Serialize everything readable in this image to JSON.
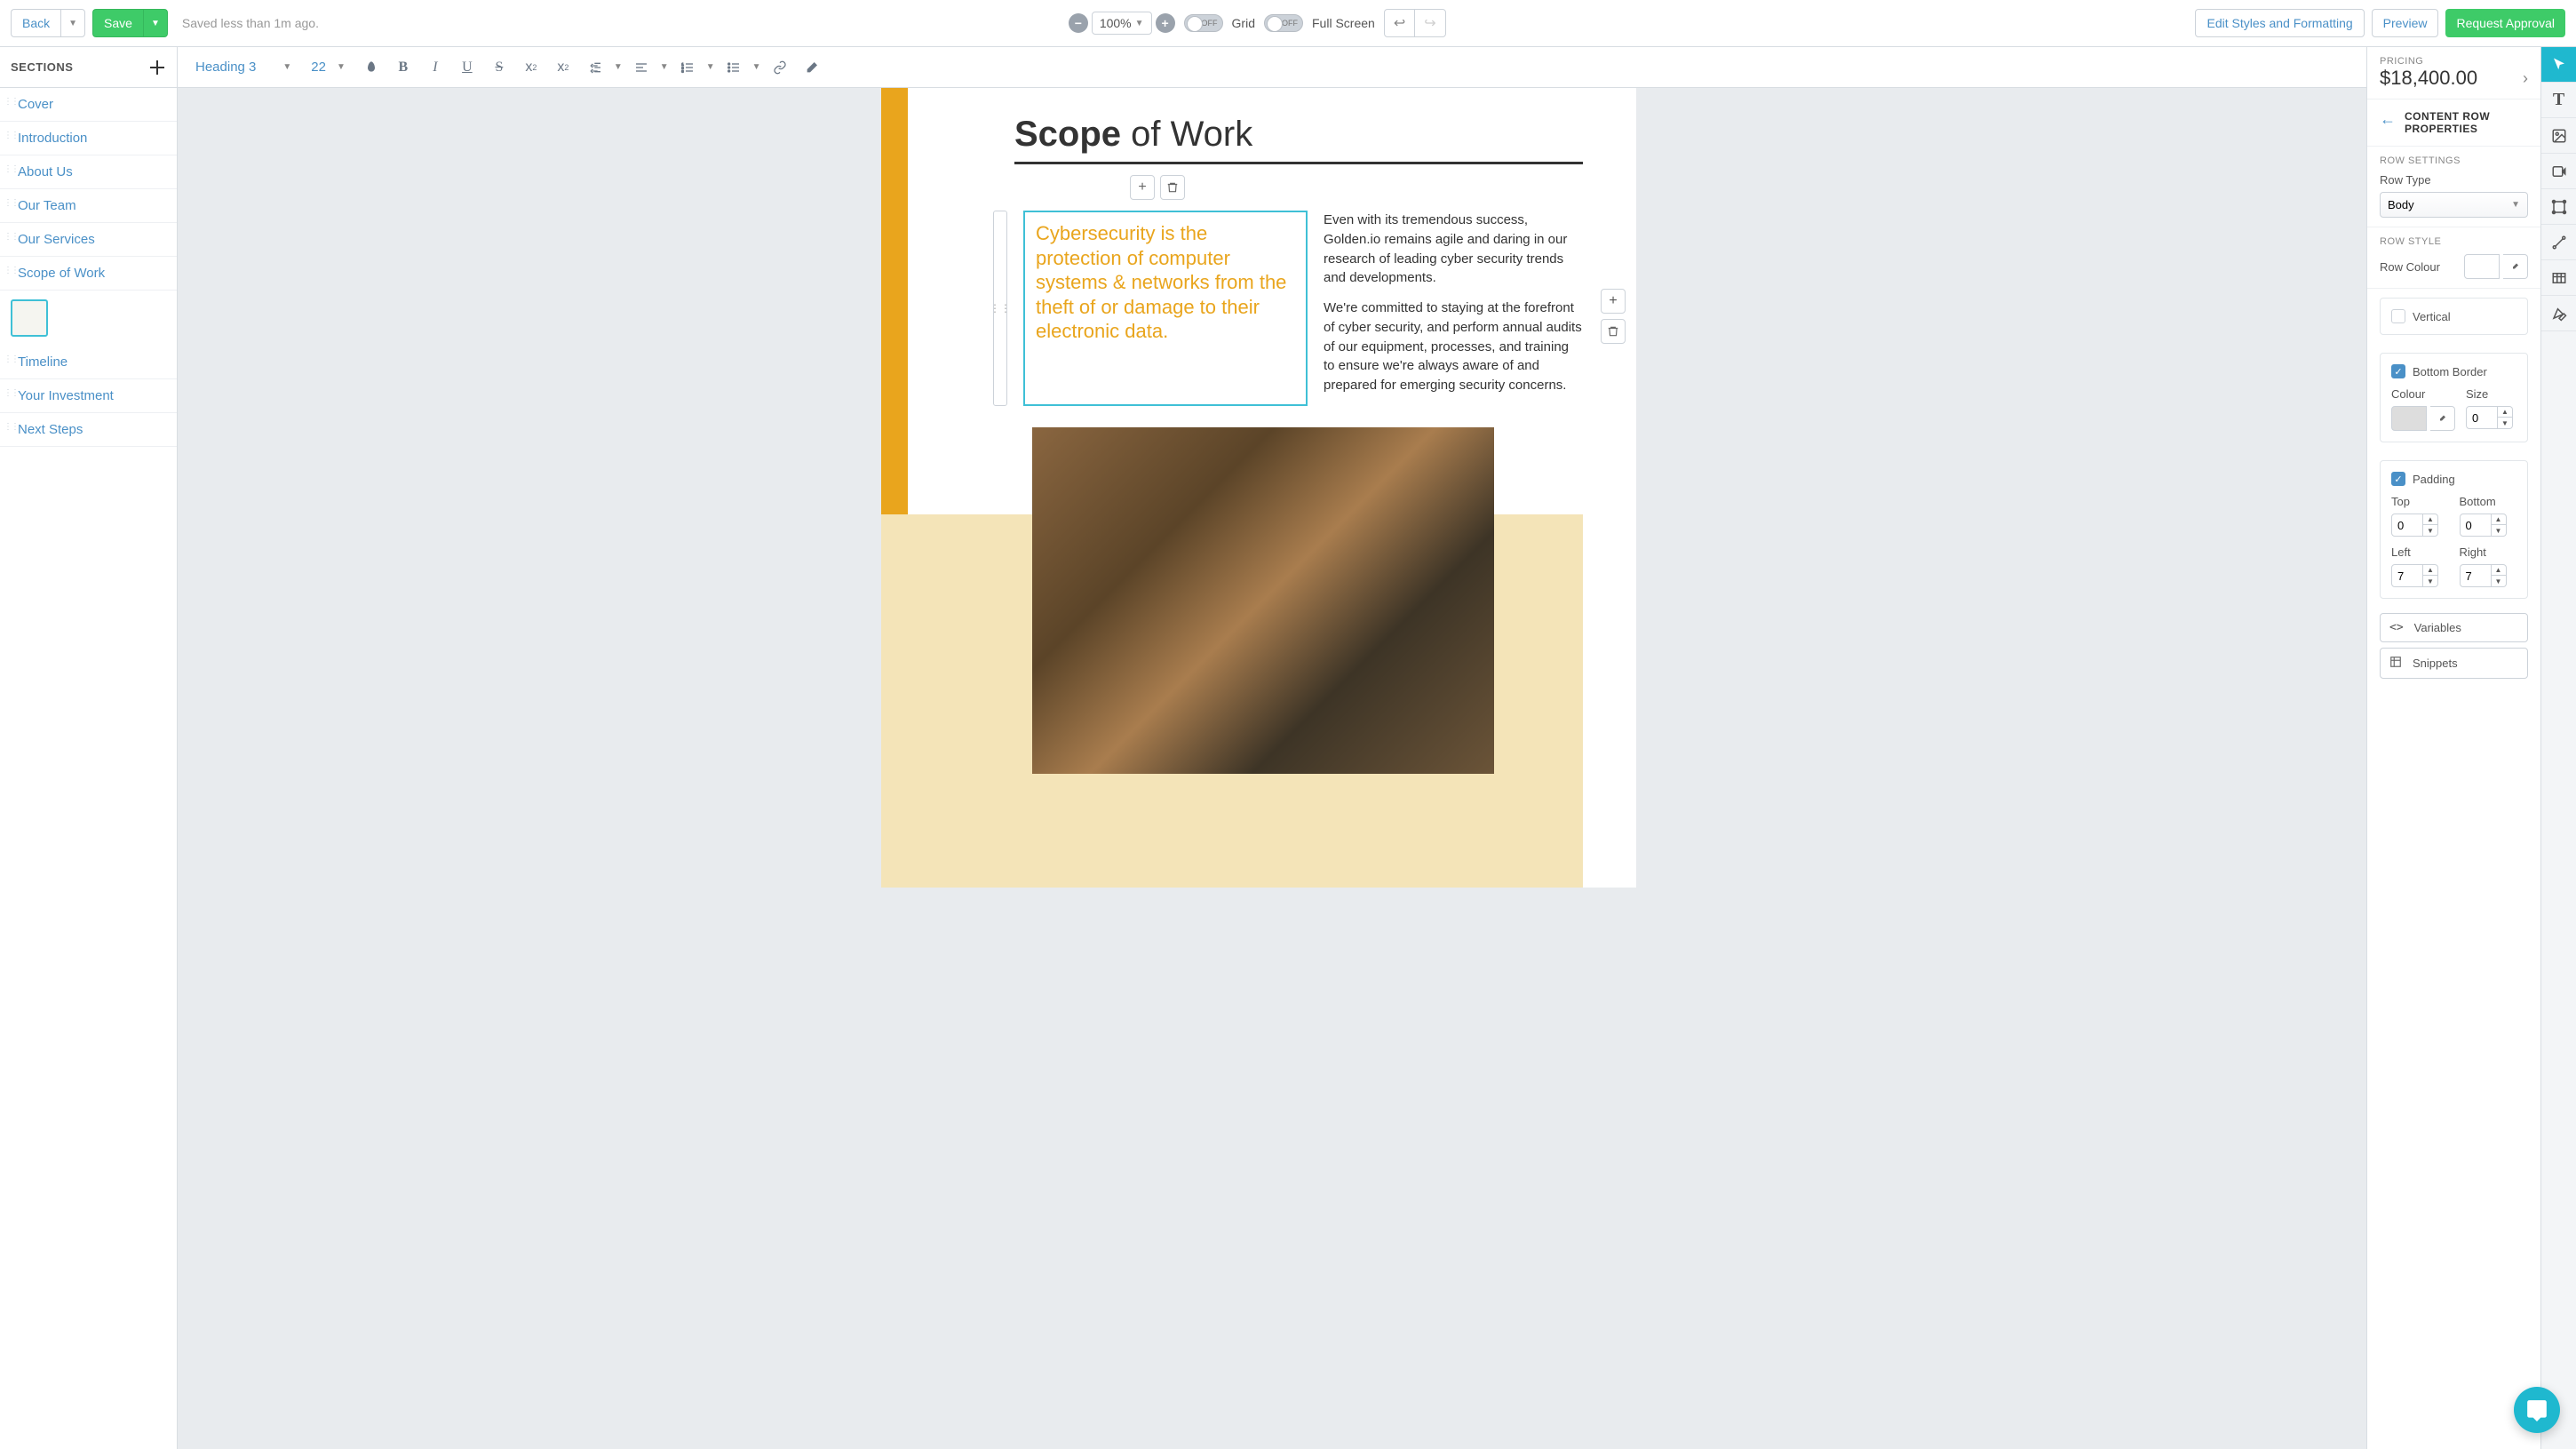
{
  "topbar": {
    "back": "Back",
    "save": "Save",
    "saved_status": "Saved less than 1m ago.",
    "zoom_value": "100%",
    "grid_toggle": "OFF",
    "grid_label": "Grid",
    "fullscreen_toggle": "OFF",
    "fullscreen_label": "Full Screen",
    "edit_styles": "Edit Styles and Formatting",
    "preview": "Preview",
    "request": "Request Approval"
  },
  "sidebar": {
    "header": "SECTIONS",
    "items": [
      {
        "label": "Cover"
      },
      {
        "label": "Introduction"
      },
      {
        "label": "About Us"
      },
      {
        "label": "Our Team"
      },
      {
        "label": "Our Services"
      },
      {
        "label": "Scope of Work",
        "active": true
      },
      {
        "label": "Timeline"
      },
      {
        "label": "Your Investment"
      },
      {
        "label": "Next Steps"
      }
    ]
  },
  "editorToolbar": {
    "style": "Heading 3",
    "size": "22"
  },
  "document": {
    "title_bold": "Scope",
    "title_rest": " of Work",
    "calloutText": "Cybersecurity is the protection of computer systems & networks from the theft of or damage to their electronic data.",
    "bodyP1": "Even with its tremendous success, Golden.io remains agile and daring in our research of leading cyber security trends and developments.",
    "bodyP2": "We're committed to staying at the forefront of cyber security, and perform annual audits of our equipment, processes, and training to ensure we're always aware of and prepared for emerging security concerns."
  },
  "pricing": {
    "label": "PRICING",
    "value": "$18,400.00"
  },
  "panel": {
    "title": "CONTENT ROW PROPERTIES",
    "row_settings": "ROW SETTINGS",
    "row_type_label": "Row Type",
    "row_type_value": "Body",
    "row_style": "ROW STYLE",
    "row_colour_label": "Row Colour",
    "vertical": "Vertical",
    "bottom_border": "Bottom Border",
    "colour": "Colour",
    "size": "Size",
    "size_value": "0",
    "padding": "Padding",
    "top": "Top",
    "top_val": "0",
    "bottom": "Bottom",
    "bottom_val": "0",
    "left": "Left",
    "left_val": "7",
    "right": "Right",
    "right_val": "7",
    "variables": "Variables",
    "snippets": "Snippets"
  }
}
